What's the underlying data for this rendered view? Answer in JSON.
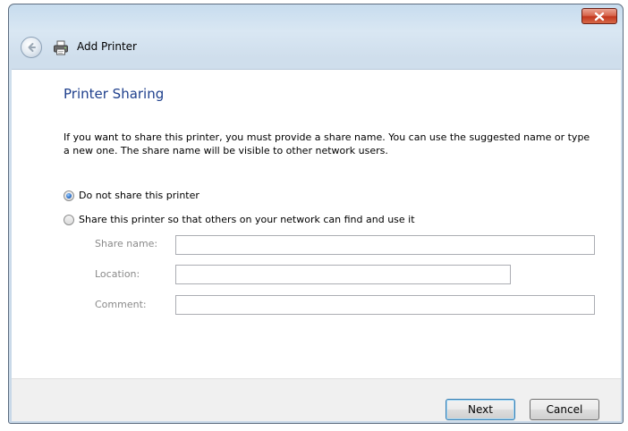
{
  "window": {
    "title": "Add Printer"
  },
  "page": {
    "heading": "Printer Sharing",
    "description": "If you want to share this printer, you must provide a share name. You can use the suggested name or type a new one. The share name will be visible to other network users."
  },
  "sharing_options": {
    "do_not_share_label": "Do not share this printer",
    "share_label": "Share this printer so that others on your network can find and use it",
    "selected": "do_not_share"
  },
  "fields": {
    "share_name_label": "Share name:",
    "share_name_value": "",
    "location_label": "Location:",
    "location_value": "",
    "comment_label": "Comment:",
    "comment_value": ""
  },
  "buttons": {
    "next": "Next",
    "cancel": "Cancel"
  },
  "icons": {
    "close": "close-icon",
    "back": "back-arrow-icon",
    "printer": "printer-icon"
  },
  "colors": {
    "heading": "#1e3f8c",
    "close_button": "#c2371e",
    "chrome": "#c8d8e8"
  }
}
